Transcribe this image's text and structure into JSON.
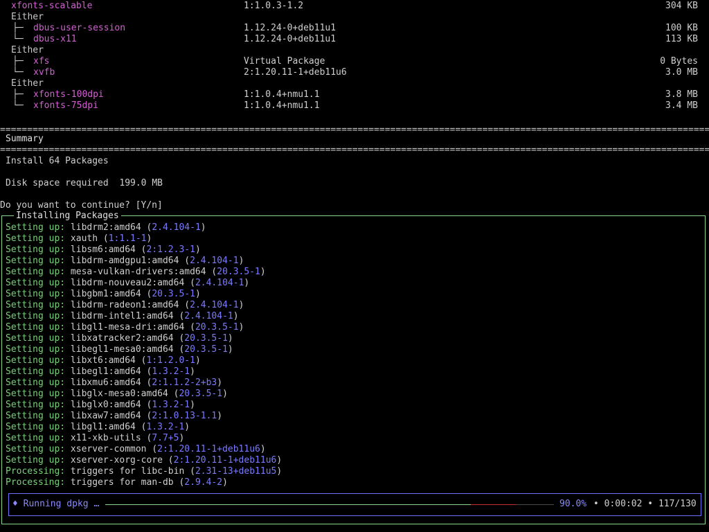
{
  "dependency_list": {
    "top_row": {
      "name": "xfonts-scalable",
      "version": "1:1.0.3-1.2",
      "size": "304 KB"
    },
    "groups": [
      {
        "label": "Either",
        "items": [
          {
            "name": "dbus-user-session",
            "version": "1.12.24-0+deb11u1",
            "size": "100 KB"
          },
          {
            "name": "dbus-x11",
            "version": "1.12.24-0+deb11u1",
            "size": "113 KB"
          }
        ]
      },
      {
        "label": "Either",
        "items": [
          {
            "name": "xfs",
            "version": "Virtual Package",
            "size": "0 Bytes"
          },
          {
            "name": "xvfb",
            "version": "2:1.20.11-1+deb11u6",
            "size": "3.0 MB"
          }
        ]
      },
      {
        "label": "Either",
        "items": [
          {
            "name": "xfonts-100dpi",
            "version": "1:1.0.4+nmu1.1",
            "size": "3.8 MB"
          },
          {
            "name": "xfonts-75dpi",
            "version": "1:1.0.4+nmu1.1",
            "size": "3.4 MB"
          }
        ]
      }
    ],
    "tree_branch": "├─",
    "tree_end": "└─"
  },
  "summary": {
    "heading": "Summary",
    "install_text": "Install 64 Packages",
    "disk_label": "Disk space required",
    "disk_value": "199.0 MB",
    "prompt": "Do you want to continue? [Y/n]"
  },
  "install_panel": {
    "title": "Installing Packages",
    "log": [
      {
        "label": "Setting up:",
        "text": "libdrm2:amd64",
        "version": "2.4.104-1"
      },
      {
        "label": "Setting up:",
        "text": "xauth",
        "version": "1:1.1-1"
      },
      {
        "label": "Setting up:",
        "text": "libsm6:amd64",
        "version": "2:1.2.3-1"
      },
      {
        "label": "Setting up:",
        "text": "libdrm-amdgpu1:amd64",
        "version": "2.4.104-1"
      },
      {
        "label": "Setting up:",
        "text": "mesa-vulkan-drivers:amd64",
        "version": "20.3.5-1"
      },
      {
        "label": "Setting up:",
        "text": "libdrm-nouveau2:amd64",
        "version": "2.4.104-1"
      },
      {
        "label": "Setting up:",
        "text": "libgbm1:amd64",
        "version": "20.3.5-1"
      },
      {
        "label": "Setting up:",
        "text": "libdrm-radeon1:amd64",
        "version": "2.4.104-1"
      },
      {
        "label": "Setting up:",
        "text": "libdrm-intel1:amd64",
        "version": "2.4.104-1"
      },
      {
        "label": "Setting up:",
        "text": "libgl1-mesa-dri:amd64",
        "version": "20.3.5-1"
      },
      {
        "label": "Setting up:",
        "text": "libxatracker2:amd64",
        "version": "20.3.5-1"
      },
      {
        "label": "Setting up:",
        "text": "libegl1-mesa0:amd64",
        "version": "20.3.5-1"
      },
      {
        "label": "Setting up:",
        "text": "libxt6:amd64",
        "version": "1:1.2.0-1"
      },
      {
        "label": "Setting up:",
        "text": "libegl1:amd64",
        "version": "1.3.2-1"
      },
      {
        "label": "Setting up:",
        "text": "libxmu6:amd64",
        "version": "2:1.1.2-2+b3"
      },
      {
        "label": "Setting up:",
        "text": "libglx-mesa0:amd64",
        "version": "20.3.5-1"
      },
      {
        "label": "Setting up:",
        "text": "libglx0:amd64",
        "version": "1.3.2-1"
      },
      {
        "label": "Setting up:",
        "text": "libxaw7:amd64",
        "version": "2:1.0.13-1.1"
      },
      {
        "label": "Setting up:",
        "text": "libgl1:amd64",
        "version": "1.3.2-1"
      },
      {
        "label": "Setting up:",
        "text": "x11-xkb-utils",
        "version": "7.7+5"
      },
      {
        "label": "Setting up:",
        "text": "xserver-common",
        "version": "2:1.20.11-1+deb11u6"
      },
      {
        "label": "Setting up:",
        "text": "xserver-xorg-core",
        "version": "2:1.20.11-1+deb11u6"
      },
      {
        "label": "Processing:",
        "text": "triggers for libc-bin",
        "version": "2.31-13+deb11u5"
      },
      {
        "label": "Processing:",
        "text": "triggers for man-db",
        "version": "2.9.4-2"
      }
    ]
  },
  "progress": {
    "label": "♦ Running dpkg …",
    "fraction": 0.9,
    "percent": "90.0%",
    "elapsed": "0:00:02",
    "count": "117/130",
    "separator": "•"
  },
  "colors": {
    "package_name": "#d35fd3",
    "log_label": "#79d279",
    "version": "#7b7bff",
    "frame_border": "#8fd68f",
    "progress_border": "#7070ff",
    "progress_remaining": "#c43030"
  }
}
